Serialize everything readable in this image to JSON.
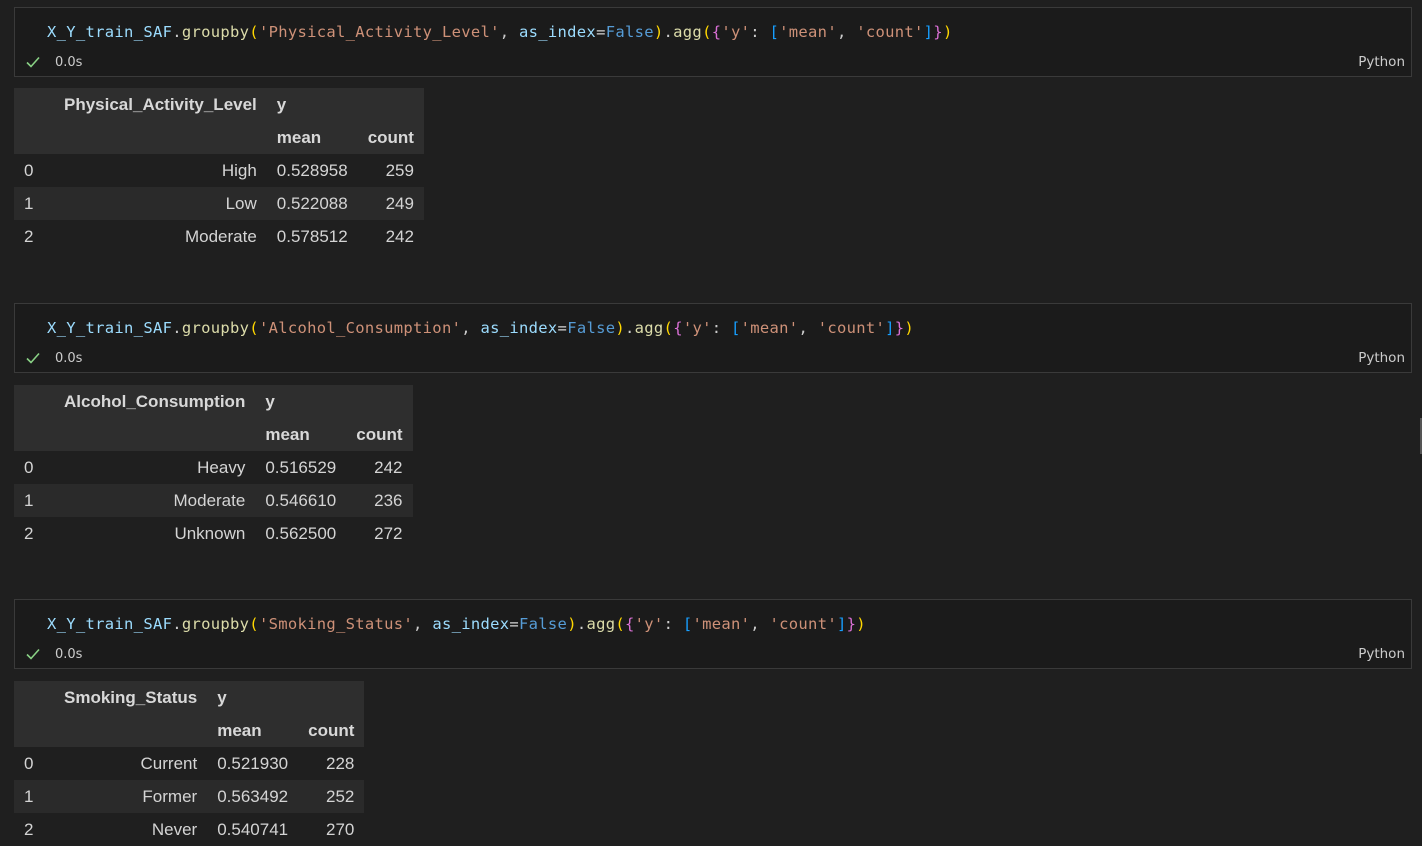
{
  "status_time": "0.0s",
  "language": "Python",
  "cells": [
    {
      "code": {
        "var": "X_Y_train_SAF",
        "method": "groupby",
        "column_arg": "'Physical_Activity_Level'",
        "kw": "as_index",
        "kw_value": "False",
        "agg": "agg",
        "key": "'y'",
        "f1": "'mean'",
        "f2": "'count'"
      },
      "table": {
        "group_col": "Physical_Activity_Level",
        "y_col": "y",
        "sub_mean": "mean",
        "sub_count": "count",
        "rows": [
          {
            "idx": "0",
            "cat": "High",
            "mean": "0.528958",
            "count": "259"
          },
          {
            "idx": "1",
            "cat": "Low",
            "mean": "0.522088",
            "count": "249"
          },
          {
            "idx": "2",
            "cat": "Moderate",
            "mean": "0.578512",
            "count": "242"
          }
        ]
      }
    },
    {
      "code": {
        "var": "X_Y_train_SAF",
        "method": "groupby",
        "column_arg": "'Alcohol_Consumption'",
        "kw": "as_index",
        "kw_value": "False",
        "agg": "agg",
        "key": "'y'",
        "f1": "'mean'",
        "f2": "'count'"
      },
      "table": {
        "group_col": "Alcohol_Consumption",
        "y_col": "y",
        "sub_mean": "mean",
        "sub_count": "count",
        "rows": [
          {
            "idx": "0",
            "cat": "Heavy",
            "mean": "0.516529",
            "count": "242"
          },
          {
            "idx": "1",
            "cat": "Moderate",
            "mean": "0.546610",
            "count": "236"
          },
          {
            "idx": "2",
            "cat": "Unknown",
            "mean": "0.562500",
            "count": "272"
          }
        ]
      }
    },
    {
      "code": {
        "var": "X_Y_train_SAF",
        "method": "groupby",
        "column_arg": "'Smoking_Status'",
        "kw": "as_index",
        "kw_value": "False",
        "agg": "agg",
        "key": "'y'",
        "f1": "'mean'",
        "f2": "'count'"
      },
      "table": {
        "group_col": "Smoking_Status",
        "y_col": "y",
        "sub_mean": "mean",
        "sub_count": "count",
        "rows": [
          {
            "idx": "0",
            "cat": "Current",
            "mean": "0.521930",
            "count": "228"
          },
          {
            "idx": "1",
            "cat": "Former",
            "mean": "0.563492",
            "count": "252"
          },
          {
            "idx": "2",
            "cat": "Never",
            "mean": "0.540741",
            "count": "270"
          }
        ]
      }
    }
  ]
}
